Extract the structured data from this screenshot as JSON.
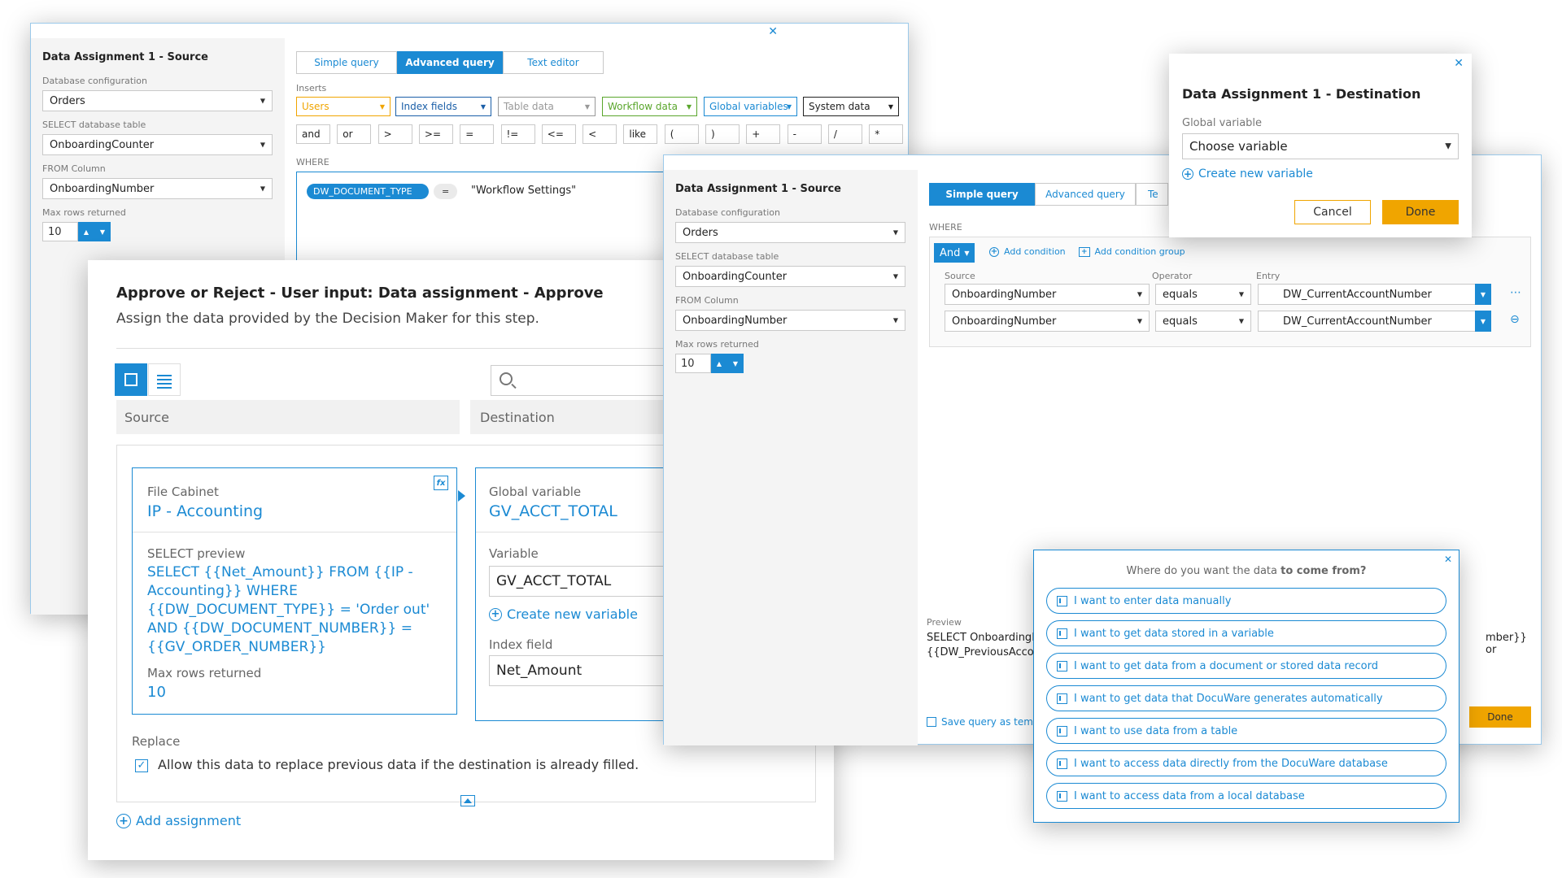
{
  "win1": {
    "title": "Data Assignment 1 - Source",
    "db_config_label": "Database configuration",
    "db_config_value": "Orders",
    "select_table_label": "SELECT database table",
    "select_table_value": "OnboardingCounter",
    "from_col_label": "FROM Column",
    "from_col_value": "OnboardingNumber",
    "max_rows_label": "Max rows returned",
    "max_rows_value": "10",
    "tabs": [
      "Simple query",
      "Advanced query",
      "Text editor"
    ],
    "active_tab": 1,
    "inserts_label": "Inserts",
    "inserts": [
      {
        "label": "Users",
        "color": "#f0a500"
      },
      {
        "label": "Index fields",
        "color": "#1b5fa8"
      },
      {
        "label": "Table data",
        "color": "#999999"
      },
      {
        "label": "Workflow data",
        "color": "#5aa62c"
      },
      {
        "label": "Global variables",
        "color": "#1b8ad3"
      },
      {
        "label": "System data",
        "color": "#222222"
      }
    ],
    "operators": [
      "and",
      "or",
      ">",
      ">=",
      "=",
      "!=",
      "<=",
      "<",
      "like",
      "(",
      ")",
      "+",
      "-",
      "/",
      "*"
    ],
    "where_label": "WHERE",
    "where_token": "DW_DOCUMENT_TYPE",
    "where_op": "=",
    "where_value": "\"Workflow Settings\""
  },
  "win2": {
    "title": "Approve or Reject - User input: Data assignment - Approve",
    "subtitle": "Assign the data provided by the Decision Maker for this step.",
    "col_source": "Source",
    "col_dest": "Destination",
    "source_card": {
      "kind": "File Cabinet",
      "name": "IP - Accounting",
      "preview_label": "SELECT preview",
      "preview_lines": [
        "SELECT {{Net_Amount}} FROM {{IP -",
        "Accounting}} WHERE",
        "{{DW_DOCUMENT_TYPE}} = 'Order out'",
        "AND {{DW_DOCUMENT_NUMBER}} =",
        "{{GV_ORDER_NUMBER}}"
      ],
      "max_rows_label": "Max rows returned",
      "max_rows_value": "10"
    },
    "dest_card": {
      "kind": "Global variable",
      "name": "GV_ACCT_TOTAL",
      "variable_label": "Variable",
      "variable_value": "GV_ACCT_TOTAL",
      "create_var": "Create new variable",
      "index_label": "Index field",
      "index_value": "Net_Amount"
    },
    "replace_label": "Replace",
    "replace_text": "Allow this data to replace previous data if the destination is already filled.",
    "add_assignment": "Add assignment"
  },
  "win3": {
    "title": "Data Assignment 1 - Source",
    "db_config_label": "Database configuration",
    "db_config_value": "Orders",
    "select_table_label": "SELECT database table",
    "select_table_value": "OnboardingCounter",
    "from_col_label": "FROM Column",
    "from_col_value": "OnboardingNumber",
    "max_rows_label": "Max rows returned",
    "max_rows_value": "10",
    "tabs": [
      "Simple query",
      "Advanced query",
      "Te"
    ],
    "where_label": "WHERE",
    "and_label": "And",
    "add_condition": "Add condition",
    "add_condition_group": "Add condition group",
    "col_source": "Source",
    "col_operator": "Operator",
    "col_entry": "Entry",
    "rows": [
      {
        "source": "OnboardingNumber",
        "operator": "equals",
        "entry": "DW_CurrentAccountNumber"
      },
      {
        "source": "OnboardingNumber",
        "operator": "equals",
        "entry": "DW_CurrentAccountNumber"
      }
    ],
    "preview_label": "Preview",
    "preview_line1": "SELECT OnboardingNu",
    "preview_line2": "{{DW_PreviousAccoun",
    "preview_right": "mber}} or",
    "save_template": "Save query as templ",
    "done": "Done"
  },
  "win4": {
    "title": "Data Assignment 1 - Destination",
    "global_label": "Global variable",
    "choose": "Choose variable",
    "create_var": "Create new variable",
    "cancel": "Cancel",
    "done": "Done"
  },
  "win5": {
    "question_pre": "Where do you want the data ",
    "question_bold": "to come from?",
    "options": [
      "I want to enter data manually",
      "I want to get data stored in a variable",
      "I want to get data from a document or stored data record",
      "I want to get data that DocuWare generates automatically",
      "I want to use data from a table",
      "I want to access data directly from the DocuWare database",
      "I want to access data from a local database"
    ]
  }
}
